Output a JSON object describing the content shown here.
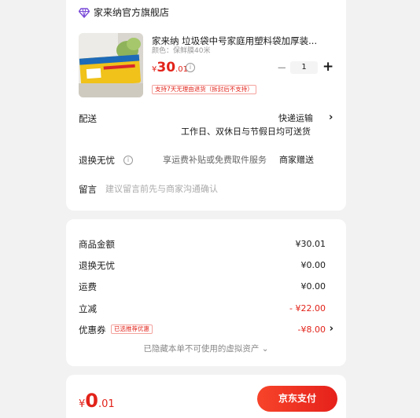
{
  "store": {
    "name": "家来纳官方旗舰店",
    "icon": "store-diamond-icon",
    "icon_color": "#7a4bd8"
  },
  "product": {
    "title": "家来纳 垃圾袋中号家庭用塑料袋加厚装...",
    "spec": "颜色：保鲜膜40米",
    "price_currency": "¥",
    "price_int": "30",
    "price_dec": ".01",
    "quantity": "1",
    "minus_label": "−",
    "plus_label": "+",
    "return_tag": "支持7天无理由退货（拆封后不支持）",
    "thumbnail_text": "保鲜膜"
  },
  "order": {
    "shipping_label": "配送",
    "shipping_value": "快递运输",
    "shipping_sub": "工作日、双休日与节假日均可送货",
    "returns_label": "退换无忧",
    "returns_value": "享运费补贴或免费取件服务",
    "returns_gift": "商家赠送",
    "message_label": "留言",
    "message_placeholder": "建议留言前先与商家沟通确认"
  },
  "summary": {
    "subtotal_label": "商品金额",
    "subtotal_value": "¥30.01",
    "returns_label": "退换无忧",
    "returns_value": "¥0.00",
    "freight_label": "运费",
    "freight_value": "¥0.00",
    "discount_label": "立减",
    "discount_value": "- ¥22.00",
    "coupon_label": "优惠券",
    "coupon_tag": "已选推荐优惠",
    "coupon_value": "-¥8.00",
    "hidden_note": "已隐藏本单不可使用的虚拟资产 ⌄"
  },
  "footer": {
    "total_currency": "¥",
    "total_int": "0",
    "total_dec": ".01",
    "pay_label": "京东支付"
  },
  "colors": {
    "accent_red": "#e2231a",
    "background": "#f2f2f2"
  }
}
